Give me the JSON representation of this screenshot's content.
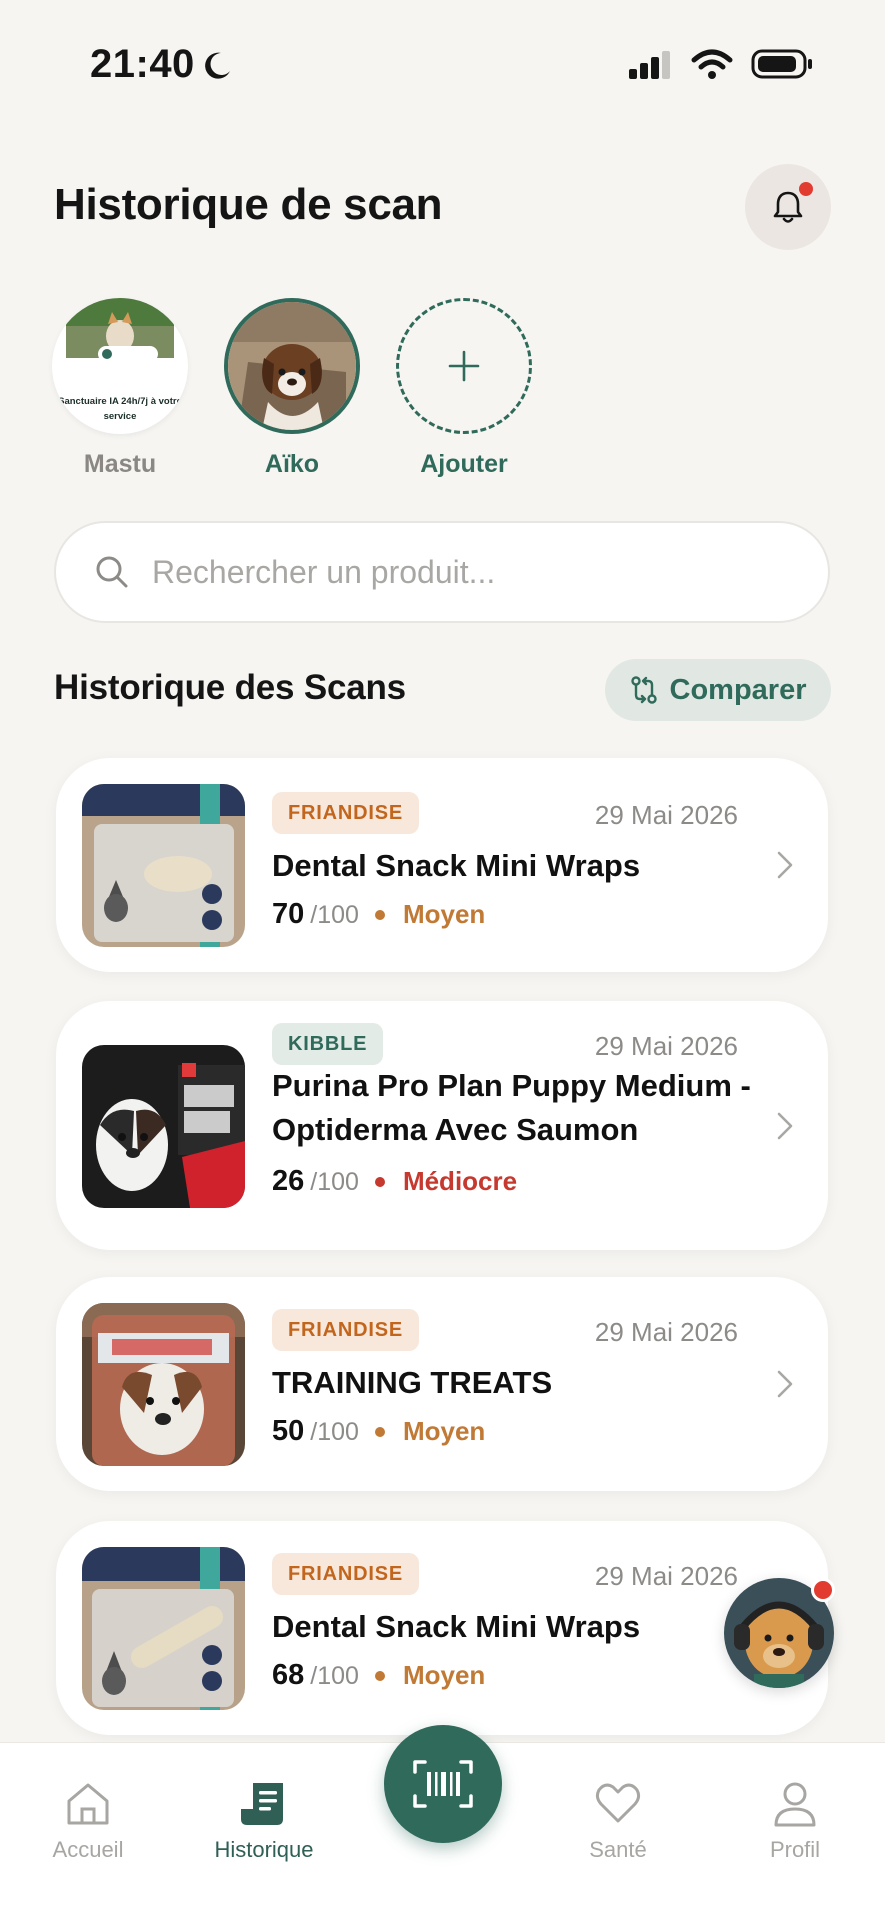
{
  "status_bar": {
    "time": "21:40"
  },
  "header": {
    "title": "Historique de scan"
  },
  "pets": {
    "mastu": {
      "name": "Mastu",
      "image_caption": "Sanctuaire IA 24h/7j à votre service"
    },
    "aiko": {
      "name": "Aïko"
    },
    "add": {
      "label": "Ajouter"
    }
  },
  "search": {
    "placeholder": "Rechercher un produit..."
  },
  "history": {
    "title": "Historique des Scans",
    "compare_label": "Comparer",
    "items": [
      {
        "category": "FRIANDISE",
        "date": "29 Mai 2026",
        "name": "Dental Snack Mini Wraps",
        "score": "70",
        "score_max": "/100",
        "rating": "Moyen"
      },
      {
        "category": "KIBBLE",
        "date": "29 Mai 2026",
        "name": "Purina Pro Plan Puppy Medium - Optiderma Avec Saumon",
        "score": "26",
        "score_max": "/100",
        "rating": "Médiocre"
      },
      {
        "category": "FRIANDISE",
        "date": "29 Mai 2026",
        "name": "TRAINING TREATS",
        "score": "50",
        "score_max": "/100",
        "rating": "Moyen"
      },
      {
        "category": "FRIANDISE",
        "date": "29 Mai 2026",
        "name": "Dental Snack Mini Wraps",
        "score": "68",
        "score_max": "/100",
        "rating": "Moyen"
      }
    ]
  },
  "nav": {
    "home": "Accueil",
    "history": "Historique",
    "health": "Santé",
    "profile": "Profil"
  },
  "colors": {
    "accent": "#2f6a5b",
    "rating_moyen": "#c17a35",
    "rating_mediocre": "#c5392f",
    "notification": "#e23b30"
  }
}
